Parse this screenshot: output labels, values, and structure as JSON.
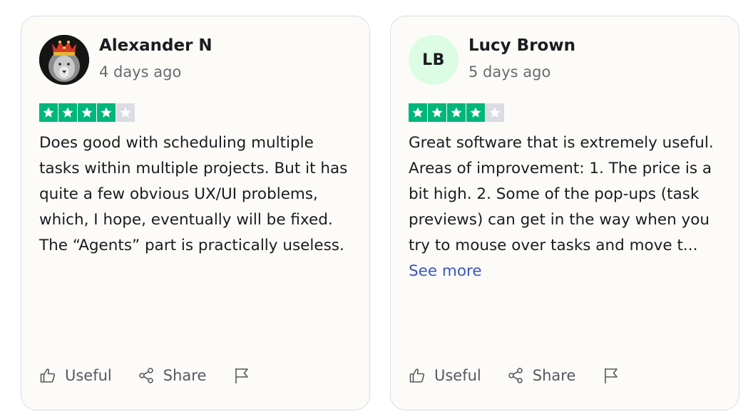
{
  "reviews": [
    {
      "name": "Alexander N",
      "date": "4 days ago",
      "avatar": "lion-avatar-photo",
      "rating": 4,
      "rating_max": 5,
      "text": "Does good with scheduling multiple tasks within multiple projects. But it has quite a few obvious UX/UI problems, which, I hope, eventually will be fixed. The “Agents” part is practically useless.",
      "see_more": ""
    },
    {
      "name": "Lucy Brown",
      "date": "5 days ago",
      "initials": "LB",
      "rating": 4,
      "rating_max": 5,
      "text": "Great software that is extremely useful. Areas of improvement: 1. The price is a bit high. 2. Some of the pop-ups (task previews) can get in the way when you try to mouse over tasks and move t...",
      "see_more": "See more"
    }
  ],
  "actions": {
    "useful_label": "Useful",
    "share_label": "Share"
  },
  "colors": {
    "star_on": "#00b67a",
    "star_off": "#dcdce6",
    "link": "#3c57bc",
    "initials_bg": "#dcfce3"
  },
  "icons": {
    "useful": "thumbs-up-icon",
    "share": "share-icon",
    "report": "flag-icon",
    "star": "star-icon"
  }
}
